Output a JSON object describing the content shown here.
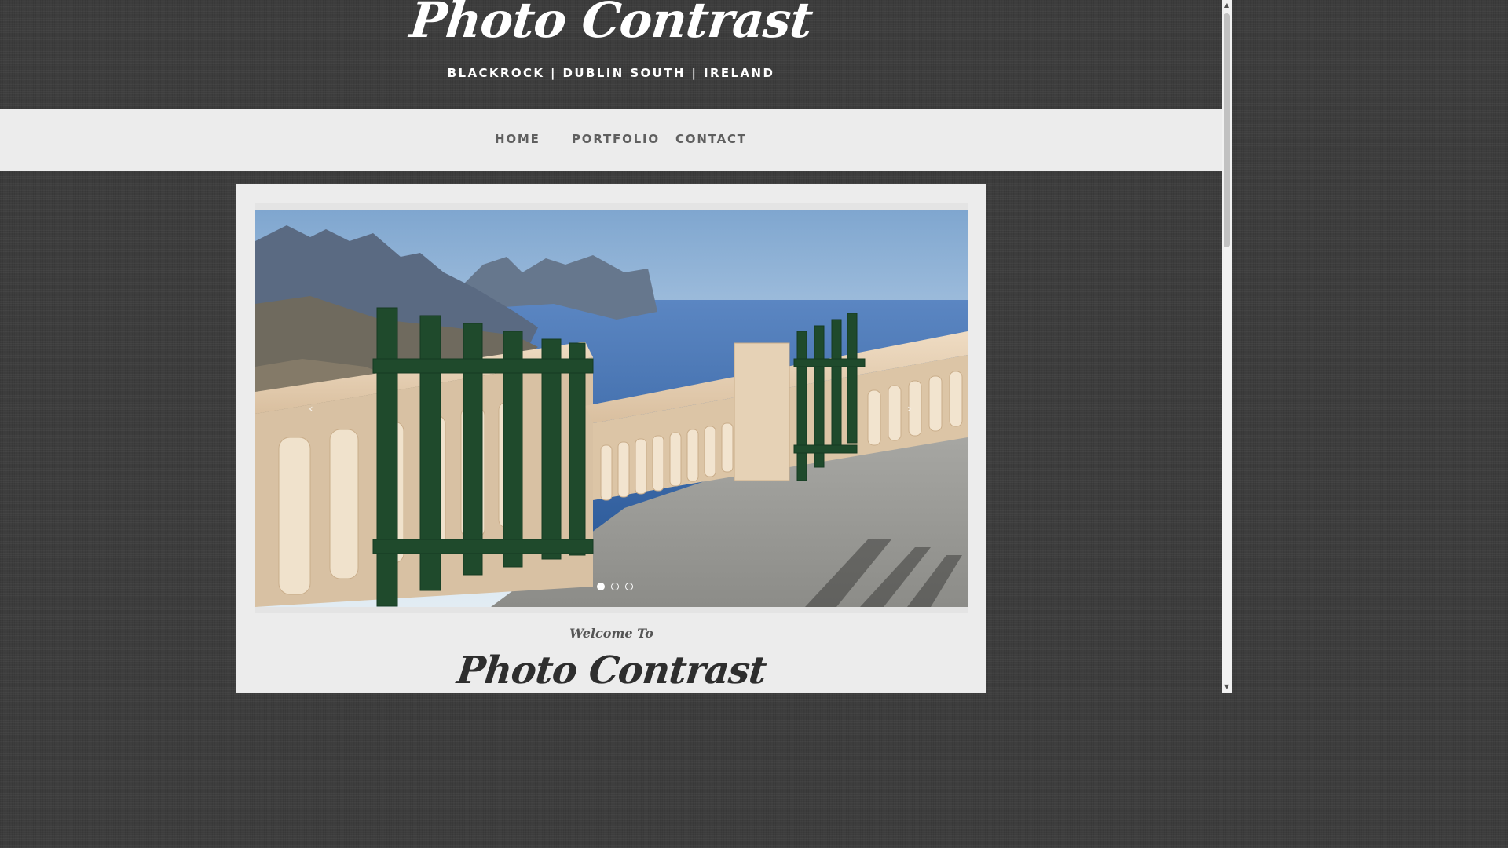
{
  "header": {
    "title": "Photo Contrast",
    "tagline": "BLACKROCK | DUBLIN SOUTH | IRELAND"
  },
  "nav": {
    "items": [
      {
        "label": "HOME"
      },
      {
        "label": "PORTFOLIO"
      },
      {
        "label": "CONTACT"
      }
    ]
  },
  "slider": {
    "prev_arrow": "‹",
    "next_arrow": "›",
    "slide_count": 3,
    "active_slide": 1,
    "image_subject": "gate-balustrade-sea-cliffs"
  },
  "welcome": {
    "intro": "Welcome To",
    "title": "Photo Contrast"
  },
  "colors": {
    "background": "#3d3d3d",
    "nav_background": "#ececec",
    "content_background": "#ececec",
    "header_text": "#ffffff",
    "nav_text": "#5f5f5f"
  }
}
